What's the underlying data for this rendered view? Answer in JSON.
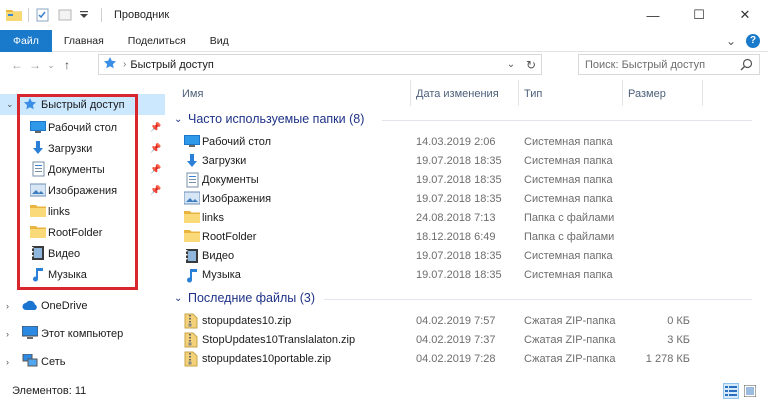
{
  "window": {
    "title": "Проводник",
    "minimize": "—",
    "maximize": "☐",
    "close": "✕"
  },
  "ribbon": {
    "tabs": [
      "Файл",
      "Главная",
      "Поделиться",
      "Вид"
    ],
    "expand": "⌄",
    "help": "?"
  },
  "address": {
    "path": "Быстрый доступ",
    "chevron": "›",
    "dropdown": "⌄",
    "refresh": "↻"
  },
  "search": {
    "placeholder": "Поиск: Быстрый доступ"
  },
  "nav": {
    "back": "←",
    "forward": "→",
    "recent": "⌄",
    "up": "↑",
    "items": [
      {
        "label": "Быстрый доступ",
        "icon": "star-icon",
        "selected": true
      },
      {
        "label": "Рабочий стол",
        "icon": "desktop-icon",
        "pinned": true
      },
      {
        "label": "Загрузки",
        "icon": "download-icon",
        "pinned": true
      },
      {
        "label": "Документы",
        "icon": "documents-icon",
        "pinned": true
      },
      {
        "label": "Изображения",
        "icon": "pictures-icon",
        "pinned": true
      },
      {
        "label": "links",
        "icon": "folder-icon"
      },
      {
        "label": "RootFolder",
        "icon": "folder-icon"
      },
      {
        "label": "Видео",
        "icon": "video-icon"
      },
      {
        "label": "Музыка",
        "icon": "music-icon"
      },
      {
        "label": "OneDrive",
        "icon": "onedrive-icon"
      },
      {
        "label": "Этот компьютер",
        "icon": "computer-icon"
      },
      {
        "label": "Сеть",
        "icon": "network-icon"
      }
    ]
  },
  "columns": {
    "name": "Имя",
    "date": "Дата изменения",
    "type": "Тип",
    "size": "Размер"
  },
  "groups": {
    "frequent": {
      "title": "Часто используемые папки (8)",
      "rows": [
        {
          "name": "Рабочий стол",
          "date": "14.03.2019 2:06",
          "type": "Системная папка",
          "size": "",
          "icon": "desktop-icon"
        },
        {
          "name": "Загрузки",
          "date": "19.07.2018 18:35",
          "type": "Системная папка",
          "size": "",
          "icon": "download-icon"
        },
        {
          "name": "Документы",
          "date": "19.07.2018 18:35",
          "type": "Системная папка",
          "size": "",
          "icon": "documents-icon"
        },
        {
          "name": "Изображения",
          "date": "19.07.2018 18:35",
          "type": "Системная папка",
          "size": "",
          "icon": "pictures-icon"
        },
        {
          "name": "links",
          "date": "24.08.2018 7:13",
          "type": "Папка с файлами",
          "size": "",
          "icon": "folder-icon"
        },
        {
          "name": "RootFolder",
          "date": "18.12.2018 6:49",
          "type": "Папка с файлами",
          "size": "",
          "icon": "folder-icon"
        },
        {
          "name": "Видео",
          "date": "19.07.2018 18:35",
          "type": "Системная папка",
          "size": "",
          "icon": "video-icon"
        },
        {
          "name": "Музыка",
          "date": "19.07.2018 18:35",
          "type": "Системная папка",
          "size": "",
          "icon": "music-icon"
        }
      ]
    },
    "recent": {
      "title": "Последние файлы (3)",
      "rows": [
        {
          "name": "stopupdates10.zip",
          "date": "04.02.2019 7:57",
          "type": "Сжатая ZIP-папка",
          "size": "0 КБ",
          "icon": "zip-icon"
        },
        {
          "name": "StopUpdates10Translalaton.zip",
          "date": "04.02.2019 7:37",
          "type": "Сжатая ZIP-папка",
          "size": "3 КБ",
          "icon": "zip-icon"
        },
        {
          "name": "stopupdates10portable.zip",
          "date": "04.02.2019 7:28",
          "type": "Сжатая ZIP-папка",
          "size": "1 278 КБ",
          "icon": "zip-icon"
        }
      ]
    }
  },
  "status": {
    "items": "Элементов: 11"
  },
  "colors": {
    "accent": "#1979ca",
    "selection": "#cce8ff",
    "group_title": "#1e3287",
    "highlight_box": "#d8262f"
  }
}
